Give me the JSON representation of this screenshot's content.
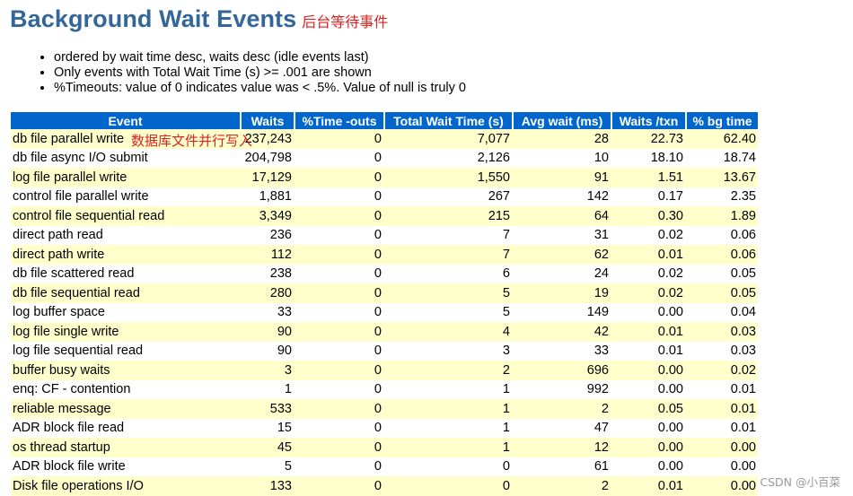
{
  "header": {
    "title": "Background Wait Events",
    "title_annotation": "后台等待事件"
  },
  "notes": [
    "ordered by wait time desc, waits desc (idle events last)",
    "Only events with Total Wait Time (s) >= .001 are shown",
    "%Timeouts: value of 0 indicates value was < .5%. Value of null is truly 0"
  ],
  "table": {
    "columns": [
      "Event",
      "Waits",
      "%Time -outs",
      "Total Wait Time (s)",
      "Avg wait (ms)",
      "Waits /txn",
      "% bg time"
    ],
    "rows": [
      [
        "db file parallel write",
        "237,243",
        "0",
        "7,077",
        "28",
        "22.73",
        "62.40"
      ],
      [
        "db file async I/O submit",
        "204,798",
        "0",
        "2,126",
        "10",
        "18.10",
        "18.74"
      ],
      [
        "log file parallel write",
        "17,129",
        "0",
        "1,550",
        "91",
        "1.51",
        "13.67"
      ],
      [
        "control file parallel write",
        "1,881",
        "0",
        "267",
        "142",
        "0.17",
        "2.35"
      ],
      [
        "control file sequential read",
        "3,349",
        "0",
        "215",
        "64",
        "0.30",
        "1.89"
      ],
      [
        "direct path read",
        "236",
        "0",
        "7",
        "31",
        "0.02",
        "0.06"
      ],
      [
        "direct path write",
        "112",
        "0",
        "7",
        "62",
        "0.01",
        "0.06"
      ],
      [
        "db file scattered read",
        "238",
        "0",
        "6",
        "24",
        "0.02",
        "0.05"
      ],
      [
        "db file sequential read",
        "280",
        "0",
        "5",
        "19",
        "0.02",
        "0.05"
      ],
      [
        "log buffer space",
        "33",
        "0",
        "5",
        "149",
        "0.00",
        "0.04"
      ],
      [
        "log file single write",
        "90",
        "0",
        "4",
        "42",
        "0.01",
        "0.03"
      ],
      [
        "log file sequential read",
        "90",
        "0",
        "3",
        "33",
        "0.01",
        "0.03"
      ],
      [
        "buffer busy waits",
        "3",
        "0",
        "2",
        "696",
        "0.00",
        "0.02"
      ],
      [
        "enq: CF - contention",
        "1",
        "0",
        "1",
        "992",
        "0.00",
        "0.01"
      ],
      [
        "reliable message",
        "533",
        "0",
        "1",
        "2",
        "0.05",
        "0.01"
      ],
      [
        "ADR block file read",
        "15",
        "0",
        "1",
        "47",
        "0.00",
        "0.01"
      ],
      [
        "os thread startup",
        "45",
        "0",
        "1",
        "12",
        "0.00",
        "0.00"
      ],
      [
        "ADR block file write",
        "5",
        "0",
        "0",
        "61",
        "0.00",
        "0.00"
      ],
      [
        "Disk file operations I/O",
        "133",
        "0",
        "0",
        "2",
        "0.01",
        "0.00"
      ]
    ],
    "row_annotation": "数据库文件并行写入"
  },
  "watermark": "CSDN @小百菜",
  "colors": {
    "title": "#336699",
    "header_bg": "#0066cc",
    "odd_row_bg": "#ffffcc",
    "annotation": "#e02020"
  }
}
